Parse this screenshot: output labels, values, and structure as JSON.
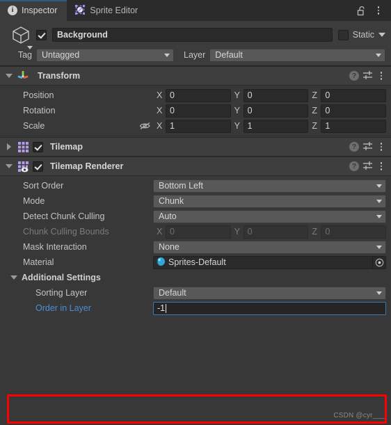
{
  "window": {
    "tabs": [
      {
        "label": "Inspector",
        "icon": "info-icon",
        "active": true
      },
      {
        "label": "Sprite Editor",
        "icon": "sprite-editor-icon",
        "active": false
      }
    ],
    "lock_icon": "unlock-icon",
    "menu_icon": "kebab-menu-icon"
  },
  "gameobject": {
    "icon": "cube-icon",
    "enabled": true,
    "name": "Background",
    "static_checked": false,
    "static_label": "Static",
    "tag_label": "Tag",
    "tag_value": "Untagged",
    "layer_label": "Layer",
    "layer_value": "Default"
  },
  "components": [
    {
      "name": "Transform",
      "icon": "transform-axis-icon",
      "expanded": true,
      "has_enable_checkbox": false,
      "rows": [
        {
          "label": "Position",
          "x": "0",
          "y": "0",
          "z": "0"
        },
        {
          "label": "Rotation",
          "x": "0",
          "y": "0",
          "z": "0"
        },
        {
          "label": "Scale",
          "x": "1",
          "y": "1",
          "z": "1",
          "constrain_icon": "eye-off-icon"
        }
      ]
    },
    {
      "name": "Tilemap",
      "icon": "tilemap-grid-icon",
      "expanded": false,
      "enabled": true
    },
    {
      "name": "Tilemap Renderer",
      "icon": "tilemap-renderer-icon",
      "expanded": true,
      "enabled": true
    }
  ],
  "tilemap_renderer": {
    "sort_order": {
      "label": "Sort Order",
      "value": "Bottom Left"
    },
    "mode": {
      "label": "Mode",
      "value": "Chunk"
    },
    "detect_chunk_culling": {
      "label": "Detect Chunk Culling",
      "value": "Auto"
    },
    "chunk_culling_bounds": {
      "label": "Chunk Culling Bounds",
      "disabled": true,
      "x": "0",
      "y": "0",
      "z": "0"
    },
    "mask_interaction": {
      "label": "Mask Interaction",
      "value": "None"
    },
    "material": {
      "label": "Material",
      "value": "Sprites-Default",
      "icon": "material-sphere-icon",
      "picker_icon": "object-picker-icon"
    },
    "additional_settings": {
      "label": "Additional Settings",
      "expanded": true,
      "sorting_layer": {
        "label": "Sorting Layer",
        "value": "Default"
      },
      "order_in_layer": {
        "label": "Order in Layer",
        "value": "-1",
        "focused": true
      }
    }
  },
  "axis_labels": {
    "x": "X",
    "y": "Y",
    "z": "Z"
  },
  "highlight": {
    "color": "#fe0000"
  },
  "watermark": {
    "text": "CSDN @cyr___"
  }
}
